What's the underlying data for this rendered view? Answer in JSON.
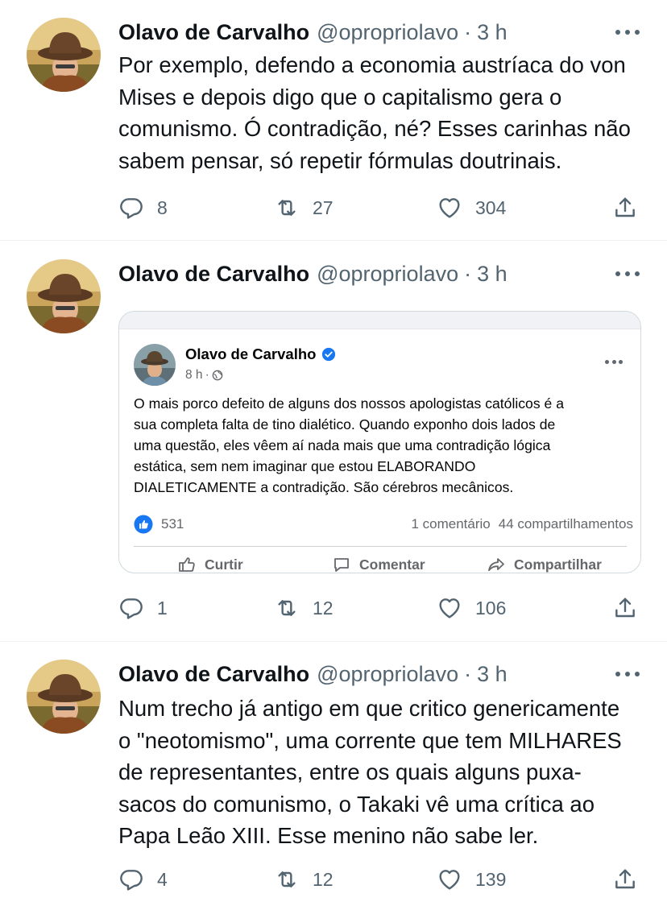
{
  "tweets": [
    {
      "author": {
        "name": "Olavo de Carvalho",
        "handle": "@opropriolavo",
        "time": "3 h"
      },
      "text_lines": [
        "Por exemplo, defendo a economia austríaca do von",
        "Mises e depois digo que o capitalismo gera o",
        "comunismo. Ó contradição, né? Esses carinhas não",
        "sabem pensar, só repetir fórmulas doutrinais."
      ],
      "stats": {
        "replies": "8",
        "retweets": "27",
        "likes": "304"
      }
    },
    {
      "author": {
        "name": "Olavo de Carvalho",
        "handle": "@opropriolavo",
        "time": "3 h"
      },
      "embedded_post": {
        "author": "Olavo de Carvalho",
        "time": "8 h",
        "text_lines": [
          "O mais porco defeito de alguns dos nossos apologistas católicos é a",
          "sua completa falta de tino dialético. Quando exponho dois lados de",
          "uma questão, eles vêem aí nada mais que uma contradição lógica",
          "estática, sem nem imaginar que estou ELABORANDO",
          "DIALETICAMENTE a contradição. São cérebros mecânicos."
        ],
        "reactions": "531",
        "comments": "1 comentário",
        "shares": "44 compartilhamentos",
        "buttons": {
          "like": "Curtir",
          "comment": "Comentar",
          "share": "Compartilhar"
        }
      },
      "stats": {
        "replies": "1",
        "retweets": "12",
        "likes": "106"
      }
    },
    {
      "author": {
        "name": "Olavo de Carvalho",
        "handle": "@opropriolavo",
        "time": "3 h"
      },
      "text_lines": [
        "Num trecho já antigo em que critico genericamente",
        "o \"neotomismo\", uma corrente que tem MILHARES",
        "de representantes, entre os quais alguns puxa-",
        "sacos do comunismo, o Takaki vê uma crítica ao",
        "Papa Leão XIII. Esse menino não sabe ler."
      ],
      "stats": {
        "replies": "4",
        "retweets": "12",
        "likes": "139"
      }
    }
  ],
  "colors": {
    "text": "#0f1419",
    "secondary": "#536471",
    "divider": "#eff3f4",
    "fb_blue": "#1877f2"
  },
  "icons": [
    "reply-icon",
    "retweet-icon",
    "like-icon",
    "share-icon",
    "more-icon",
    "verified-icon",
    "globe-icon",
    "thumbs-up-icon",
    "comment-icon",
    "share-arrow-icon"
  ]
}
